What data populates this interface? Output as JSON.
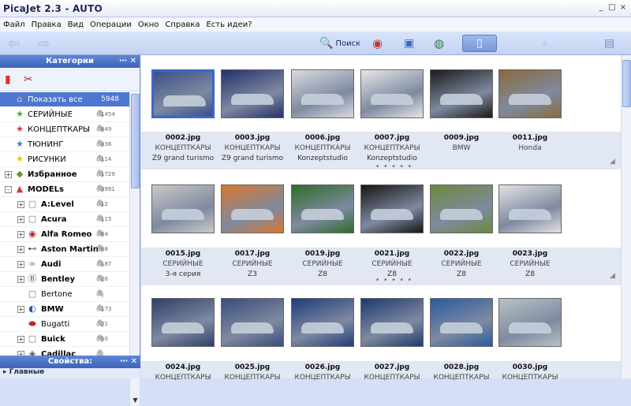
{
  "app": {
    "title": "PicaJet 2.3 - AUTO",
    "window_controls": [
      "_",
      "□",
      "×"
    ]
  },
  "menu": [
    "Файл",
    "Правка",
    "Вид",
    "Операции",
    "Окно",
    "Справка",
    "Есть идеи?"
  ],
  "toolbar": {
    "search_label": "Поиск"
  },
  "left_pane": {
    "header": "Категории",
    "rows": [
      {
        "label": "Показать все",
        "count": "5948",
        "selected": true
      },
      {
        "label": "СЕРИЙНЫЕ",
        "count": "1454"
      },
      {
        "label": "КОНЦЕПТКАРЫ",
        "count": "849"
      },
      {
        "label": "ТЮНИНГ",
        "count": "336"
      },
      {
        "label": "РИСУНКИ",
        "count": "114"
      },
      {
        "label": "Избранное",
        "count": "1729",
        "bold": true
      },
      {
        "label": "MODELs",
        "count": "3991",
        "bold": true
      },
      {
        "label": "A:Level",
        "count": "12",
        "bold": true
      },
      {
        "label": "Acura",
        "count": "115",
        "bold": true
      },
      {
        "label": "Alfa Romeo",
        "count": "64",
        "bold": true
      },
      {
        "label": "Aston Martin",
        "count": "68",
        "bold": true
      },
      {
        "label": "Audi",
        "count": "187",
        "bold": true
      },
      {
        "label": "Bentley",
        "count": "26",
        "bold": true
      },
      {
        "label": "Bertone",
        "count": ""
      },
      {
        "label": "BMW",
        "count": "173",
        "bold": true
      },
      {
        "label": "Bugatti",
        "count": "21"
      },
      {
        "label": "Buick",
        "count": "50",
        "bold": true
      },
      {
        "label": "Cadillac",
        "count": "",
        "bold": true
      }
    ],
    "properties_header": "Свойства:",
    "properties_row": "Главные"
  },
  "thumbnails": [
    {
      "file": "0002.jpg",
      "type": "КОНЦЕПТКАРЫ",
      "desc": "Z9 grand turismo",
      "color": "#3b4f8a",
      "selected": true
    },
    {
      "file": "0003.jpg",
      "type": "КОНЦЕПТКАРЫ",
      "desc": "Z9 grand turismo",
      "color": "#24306b"
    },
    {
      "file": "0006.jpg",
      "type": "КОНЦЕПТКАРЫ",
      "desc": "Konzeptstudio",
      "color": "#d9dbe0"
    },
    {
      "file": "0007.jpg",
      "type": "КОНЦЕПТКАРЫ",
      "desc": "Konzeptstudio",
      "color": "#e6e6e6"
    },
    {
      "file": "0009.jpg",
      "type": "BMW",
      "desc": "",
      "color": "#1a1a1a"
    },
    {
      "file": "0011.jpg",
      "type": "Honda",
      "desc": "",
      "color": "#8a6a3c"
    },
    {
      "file": "0015.jpg",
      "type": "СЕРИЙНЫЕ",
      "desc": "3-я серия",
      "color": "#c9c9c9"
    },
    {
      "file": "0017.jpg",
      "type": "СЕРИЙНЫЕ",
      "desc": "Z3",
      "color": "#d7772e"
    },
    {
      "file": "0019.jpg",
      "type": "СЕРИЙНЫЕ",
      "desc": "Z8",
      "color": "#2f6b2c"
    },
    {
      "file": "0021.jpg",
      "type": "СЕРИЙНЫЕ",
      "desc": "Z8",
      "color": "#151515"
    },
    {
      "file": "0022.jpg",
      "type": "СЕРИЙНЫЕ",
      "desc": "Z8",
      "color": "#6a8a3a"
    },
    {
      "file": "0023.jpg",
      "type": "СЕРИЙНЫЕ",
      "desc": "Z8",
      "color": "#e2e2e2"
    },
    {
      "file": "0024.jpg",
      "type": "КОНЦЕПТКАРЫ",
      "desc": "",
      "color": "#2f3f6a"
    },
    {
      "file": "0025.jpg",
      "type": "КОНЦЕПТКАРЫ",
      "desc": "",
      "color": "#3a4d7a"
    },
    {
      "file": "0026.jpg",
      "type": "КОНЦЕПТКАРЫ",
      "desc": "",
      "color": "#1f3c7a"
    },
    {
      "file": "0027.jpg",
      "type": "КОНЦЕПТКАРЫ",
      "desc": "",
      "color": "#1d3a6e"
    },
    {
      "file": "0028.jpg",
      "type": "КОНЦЕПТКАРЫ",
      "desc": "",
      "color": "#2a5aa0"
    },
    {
      "file": "0030.jpg",
      "type": "КОНЦЕПТКАРЫ",
      "desc": "",
      "color": "#b7c1c6"
    }
  ],
  "colors": {
    "accent": "#3a67c9",
    "header_blue": "#4d77cf"
  }
}
